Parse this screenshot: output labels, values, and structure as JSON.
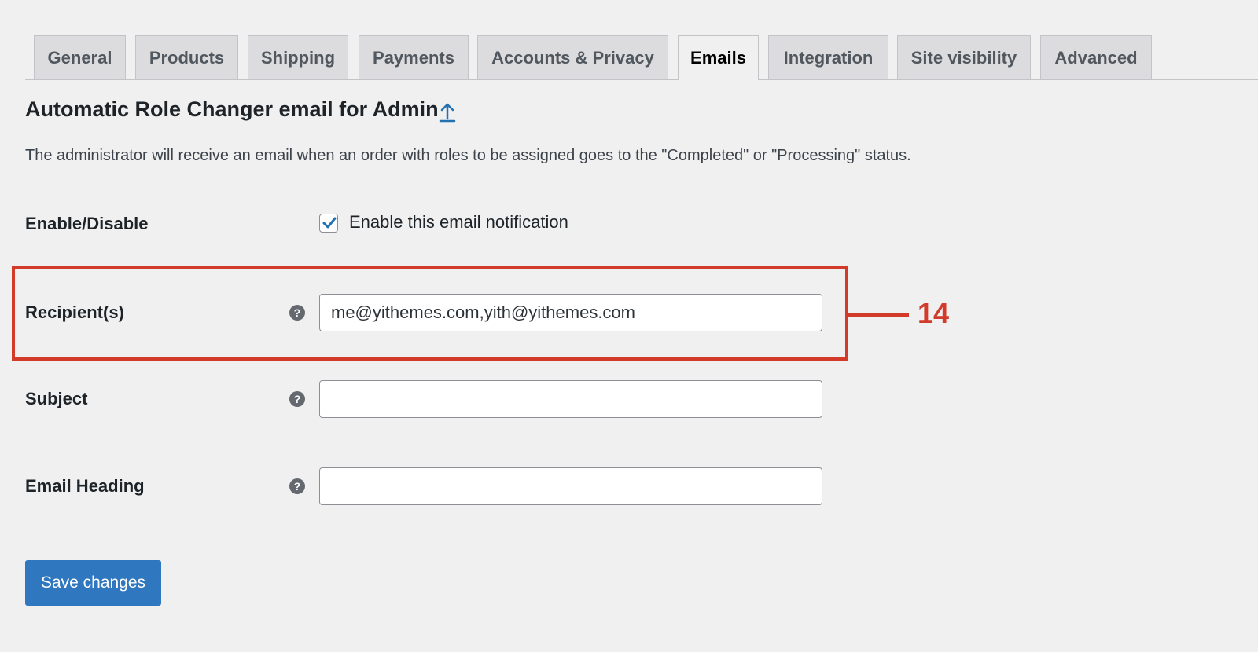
{
  "tabs": [
    {
      "label": "General",
      "active": false
    },
    {
      "label": "Products",
      "active": false
    },
    {
      "label": "Shipping",
      "active": false
    },
    {
      "label": "Payments",
      "active": false
    },
    {
      "label": "Accounts & Privacy",
      "active": false
    },
    {
      "label": "Emails",
      "active": true
    },
    {
      "label": "Integration",
      "active": false
    },
    {
      "label": "Site visibility",
      "active": false
    },
    {
      "label": "Advanced",
      "active": false
    }
  ],
  "page": {
    "title": "Automatic Role Changer email for Admin",
    "description": "The administrator will receive an email when an order with roles to be assigned goes to the \"Completed\" or \"Processing\" status."
  },
  "form": {
    "enable": {
      "label": "Enable/Disable",
      "checkbox_label": "Enable this email notification",
      "checked": true
    },
    "recipients": {
      "label": "Recipient(s)",
      "value": "me@yithemes.com,yith@yithemes.com"
    },
    "subject": {
      "label": "Subject",
      "value": ""
    },
    "heading": {
      "label": "Email Heading",
      "value": ""
    },
    "help_glyph": "?"
  },
  "annotation": {
    "number": "14",
    "color": "#d23b2a"
  },
  "save_button": {
    "label": "Save changes",
    "color": "#2f77be"
  }
}
